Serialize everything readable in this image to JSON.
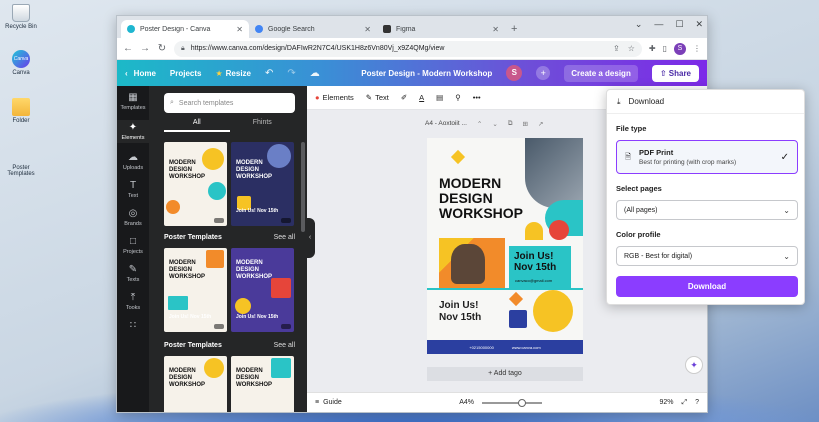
{
  "desktop": {
    "icons": [
      {
        "label": "Recycle Bin",
        "kind": "bin"
      },
      {
        "label": "Canva",
        "kind": "canva"
      },
      {
        "label": "Folder",
        "kind": "folder"
      },
      {
        "label": "Poster Templates",
        "kind": "poster"
      }
    ]
  },
  "browser": {
    "tabs": [
      {
        "title": "Poster Design - Canva",
        "color": "#1fb6d0"
      },
      {
        "title": "Google Search",
        "color": "#4285f4"
      },
      {
        "title": "Figma",
        "color": "#333333"
      }
    ],
    "url": "https://www.canva.com/design/DAFIwR2N7C4/USK1H8z6Vn80Vj_x9Z4QMg/view",
    "profile_initial": "S"
  },
  "canva_top": {
    "home": "Home",
    "projects": "Projects",
    "resize": "Resize",
    "doc_title": "Poster Design - Modern Workshop",
    "avatar": "S",
    "create": "Create a design",
    "share": "Share"
  },
  "rail": [
    {
      "label": "Templates",
      "icon": "▦"
    },
    {
      "label": "Elements",
      "icon": "✦"
    },
    {
      "label": "Uploads",
      "icon": "☁"
    },
    {
      "label": "Text",
      "icon": "T"
    },
    {
      "label": "Brands",
      "icon": "◎"
    },
    {
      "label": "Projects",
      "icon": "□"
    },
    {
      "label": "Texts",
      "icon": "✎"
    },
    {
      "label": "Tooks",
      "icon": "⤒"
    },
    {
      "label": "",
      "icon": "∷"
    }
  ],
  "panel": {
    "search_placeholder": "Search templates",
    "tabs": [
      "All",
      "Fhints"
    ],
    "section1": {
      "title": "Poster Templates",
      "see_all": "See all"
    },
    "section2": {
      "title": "Poster Templates",
      "see_all": "See all"
    },
    "thumb_title": "MODERN DESIGN WORKSHOP",
    "thumb_join": "Join Us! Nov 15th"
  },
  "toolbar": {
    "elements": "Elements",
    "text": "Text"
  },
  "page_label": "A4 - Aoxtoiit ...",
  "poster": {
    "title": "MODERN DESIGN WORKSHOP",
    "join_box": "Join Us! Nov 15th",
    "email": "canvaco@gmail.com",
    "join_bottom": "Join Us! Nov 15th",
    "phone": "+0215000000",
    "site": "www.canva.com",
    "colors": {
      "teal": "#2ac4c6",
      "yellow": "#f6c324",
      "orange": "#f28b2a",
      "blue": "#2b3fa0",
      "red": "#e6453a"
    }
  },
  "add_tag": "+ Add tago",
  "bottom": {
    "guide": "Guide",
    "page_size": "A4%",
    "zoom": "92%",
    "zoom_fraction": 0.6
  },
  "download": {
    "title": "Download",
    "file_type_label": "File type",
    "file_type": "PDF Print",
    "file_type_desc": "Best for printing (with crop marks)",
    "select_pages_label": "Select pages",
    "select_pages": "(All pages)",
    "color_profile_label": "Color profile",
    "color_profile": "RGB - Best for digital)",
    "button": "Download",
    "accent": "#8b3dff"
  }
}
